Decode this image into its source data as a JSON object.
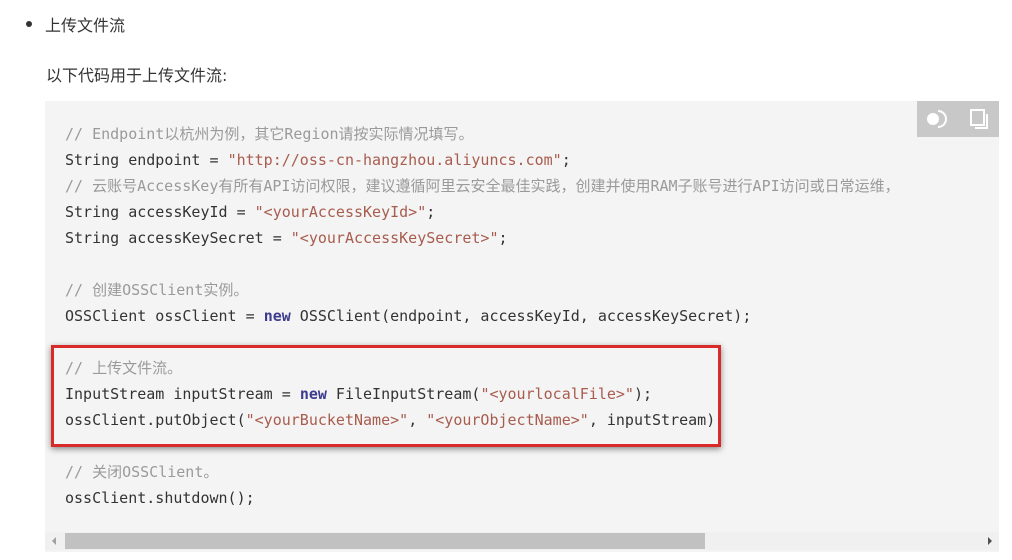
{
  "section": {
    "bullet_title": "上传文件流",
    "intro": "以下代码用于上传文件流:"
  },
  "code": {
    "lines": [
      [
        {
          "t": "// Endpoint以杭州为例，其它Region请按实际情况填写。",
          "c": "cm"
        }
      ],
      [
        {
          "t": "String endpoint = ",
          "c": ""
        },
        {
          "t": "\"http://oss-cn-hangzhou.aliyuncs.com\"",
          "c": "str"
        },
        {
          "t": ";",
          "c": ""
        }
      ],
      [
        {
          "t": "// 云账号AccessKey有所有API访问权限，建议遵循阿里云安全最佳实践，创建并使用RAM子账号进行API访问或日常运维，",
          "c": "cm"
        }
      ],
      [
        {
          "t": "String accessKeyId = ",
          "c": ""
        },
        {
          "t": "\"<yourAccessKeyId>\"",
          "c": "str"
        },
        {
          "t": ";",
          "c": ""
        }
      ],
      [
        {
          "t": "String accessKeySecret = ",
          "c": ""
        },
        {
          "t": "\"<yourAccessKeySecret>\"",
          "c": "str"
        },
        {
          "t": ";",
          "c": ""
        }
      ],
      [],
      [
        {
          "t": "// 创建OSSClient实例。",
          "c": "cm"
        }
      ],
      [
        {
          "t": "OSSClient ossClient = ",
          "c": ""
        },
        {
          "t": "new",
          "c": "kw"
        },
        {
          "t": " OSSClient(endpoint, accessKeyId, accessKeySecret);",
          "c": ""
        }
      ],
      [],
      [
        {
          "t": "// 上传文件流。",
          "c": "cm"
        }
      ],
      [
        {
          "t": "InputStream inputStream = ",
          "c": ""
        },
        {
          "t": "new",
          "c": "kw"
        },
        {
          "t": " FileInputStream(",
          "c": ""
        },
        {
          "t": "\"<yourlocalFile>\"",
          "c": "str"
        },
        {
          "t": ");",
          "c": ""
        }
      ],
      [
        {
          "t": "ossClient.putObject(",
          "c": ""
        },
        {
          "t": "\"<yourBucketName>\"",
          "c": "str"
        },
        {
          "t": ", ",
          "c": ""
        },
        {
          "t": "\"<yourObjectName>\"",
          "c": "str"
        },
        {
          "t": ", inputStream);",
          "c": ""
        }
      ],
      [],
      [
        {
          "t": "// 关闭OSSClient。",
          "c": "cm"
        }
      ],
      [
        {
          "t": "ossClient.shutdown();",
          "c": ""
        }
      ]
    ]
  },
  "toolbar": {
    "theme_toggle_icon": "theme-toggle-icon",
    "copy_icon": "copy-icon"
  },
  "colors": {
    "highlight_border": "#d92a2a",
    "code_bg": "#f4f4f4",
    "comment": "#9a9a9a",
    "string": "#a85c4e",
    "keyword": "#3d3c8f"
  }
}
